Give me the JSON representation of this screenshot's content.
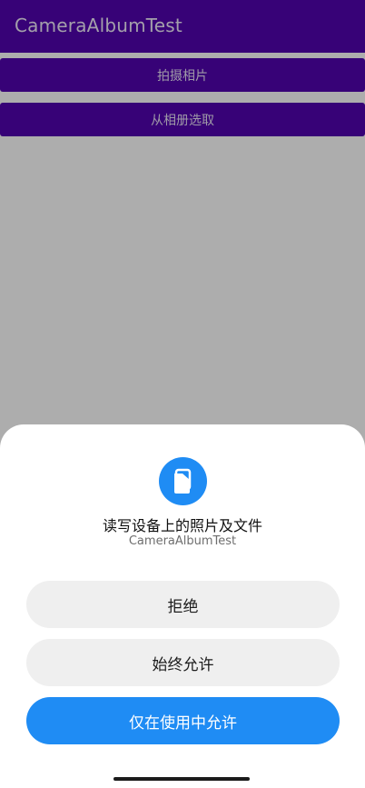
{
  "appbar": {
    "title": "CameraAlbumTest"
  },
  "buttons": {
    "take_photo": "拍摄相片",
    "choose_from_album": "从相册选取"
  },
  "permission_dialog": {
    "icon": "files-icon",
    "title": "读写设备上的照片及文件",
    "app_name": "CameraAlbumTest",
    "deny_label": "拒绝",
    "always_allow_label": "始终允许",
    "allow_while_using_label": "仅在使用中允许"
  },
  "colors": {
    "appbar": "#5203b0",
    "primary_button": "#1f8cf4",
    "secondary_button": "#efefef",
    "scrim": "rgba(0,0,0,0.32)"
  }
}
